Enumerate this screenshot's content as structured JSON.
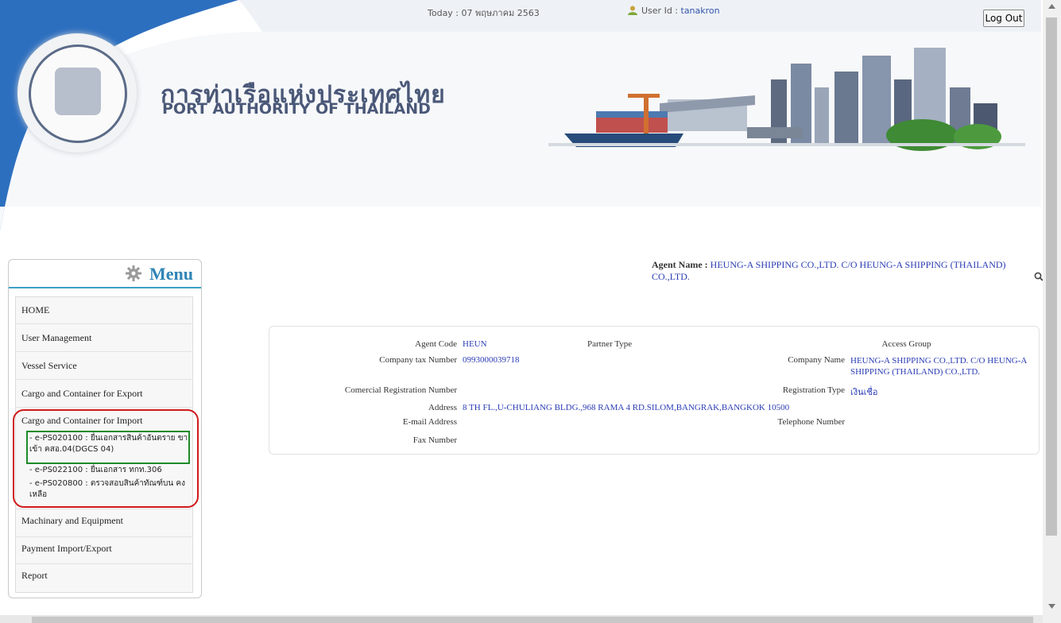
{
  "header": {
    "today_label": "Today : 07 พฤษภาคม 2563",
    "user_label": "User Id : ",
    "user_id": "tanakron",
    "logout_label": "Log Out",
    "title_th": "การท่าเรือแห่งประเทศไทย",
    "title_en": "PORT AUTHORITY OF THAILAND"
  },
  "menu": {
    "title": "Menu",
    "items": [
      {
        "label": "HOME"
      },
      {
        "label": "User Management"
      },
      {
        "label": "Vessel Service"
      },
      {
        "label": "Cargo and Container for Export"
      },
      {
        "label": "Cargo and Container for Import"
      },
      {
        "label": "Machinary and Equipment"
      },
      {
        "label": "Payment Import/Export"
      },
      {
        "label": "Report"
      }
    ],
    "import_submenu": [
      {
        "label": "- e-PS020100 : ยื่นเอกสารสินค้าอันตราย ขาเข้า คสอ.04(DGCS 04)"
      },
      {
        "label": "- e-PS022100 : ยื่นเอกสาร ทกท.306"
      },
      {
        "label": "- e-PS020800 : ตรวจสอบสินค้าทัณฑ์บน คงเหลือ"
      }
    ]
  },
  "agent": {
    "label": "Agent Name : ",
    "name": "HEUNG-A SHIPPING CO.,LTD. C/O HEUNG-A SHIPPING (THAILAND) CO.,LTD."
  },
  "info": {
    "agent_code_label": "Agent Code",
    "agent_code": "HEUN",
    "partner_type_label": "Partner Type",
    "access_group_label": "Access Group",
    "tax_label": "Company tax Number",
    "tax": "0993000039718",
    "company_name_label": "Company Name",
    "company_name": "HEUNG-A SHIPPING CO.,LTD. C/O HEUNG-A SHIPPING (THAILAND) CO.,LTD.",
    "comreg_label": "Comercial Registration Number",
    "regtype_label": "Registration Type",
    "regtype": "เงินเชื่อ",
    "address_label": "Address",
    "address": "8 TH FL.,U-CHULIANG BLDG.,968 RAMA 4 RD.SILOM,BANGRAK,BANGKOK 10500",
    "email_label": "E-mail Address",
    "phone_label": "Telephone Number",
    "fax_label": "Fax Number"
  },
  "colors": {
    "link_blue": "#2a3cb4",
    "menu_blue": "#2f84b6",
    "highlight_red": "#d11a1a",
    "highlight_green": "#1e8a2a"
  }
}
